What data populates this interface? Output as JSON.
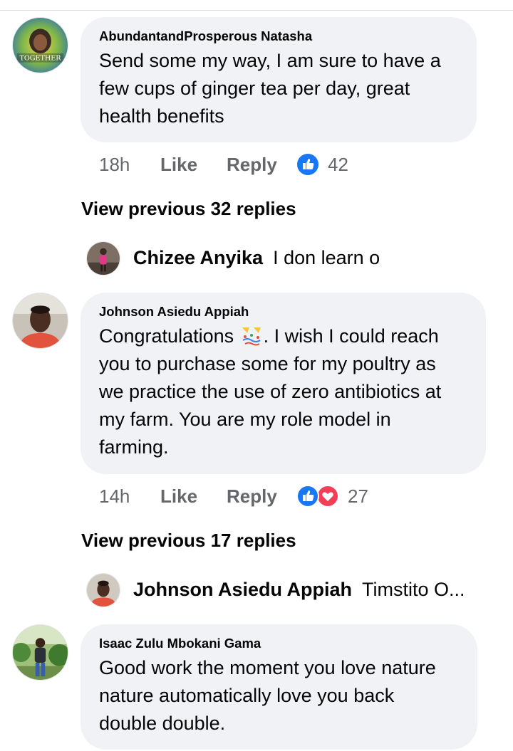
{
  "comments": [
    {
      "author": "AbundantandProsperous Natasha",
      "lines": [
        "Send some my way, I am sure to have a",
        "few cups of ginger tea per day, great",
        "health benefits"
      ],
      "time": "18h",
      "like": "Like",
      "reply": "Reply",
      "reactions": [
        "like"
      ],
      "count": "42",
      "avatar_text": "TOGETHER"
    },
    {
      "author": "Johnson Asiedu Appiah",
      "line1_text": "Congratulations",
      "line1_after": ". I wish I could reach",
      "lines": [
        "you to purchase some for my poultry as",
        "we practice the use of zero antibiotics at",
        "my farm. You are my role model in",
        "farming."
      ],
      "time": "14h",
      "like": "Like",
      "reply": "Reply",
      "reactions": [
        "like",
        "love"
      ],
      "count": "27"
    },
    {
      "author": "Isaac Zulu Mbokani Gama",
      "lines": [
        "Good work the moment you love nature",
        "nature automatically love you back",
        "double double."
      ]
    }
  ],
  "view_previous": [
    "View previous 32 replies",
    "View previous 17 replies"
  ],
  "replies": [
    {
      "name": "Chizee Anyika",
      "text": "I don learn o"
    },
    {
      "name": "Johnson Asiedu Appiah",
      "text": "Timstito O..."
    }
  ],
  "colors": {
    "bubble": "#f0f2f5",
    "meta": "#65676b",
    "like_blue": "#1877f2",
    "love_red": "#f33e58"
  }
}
